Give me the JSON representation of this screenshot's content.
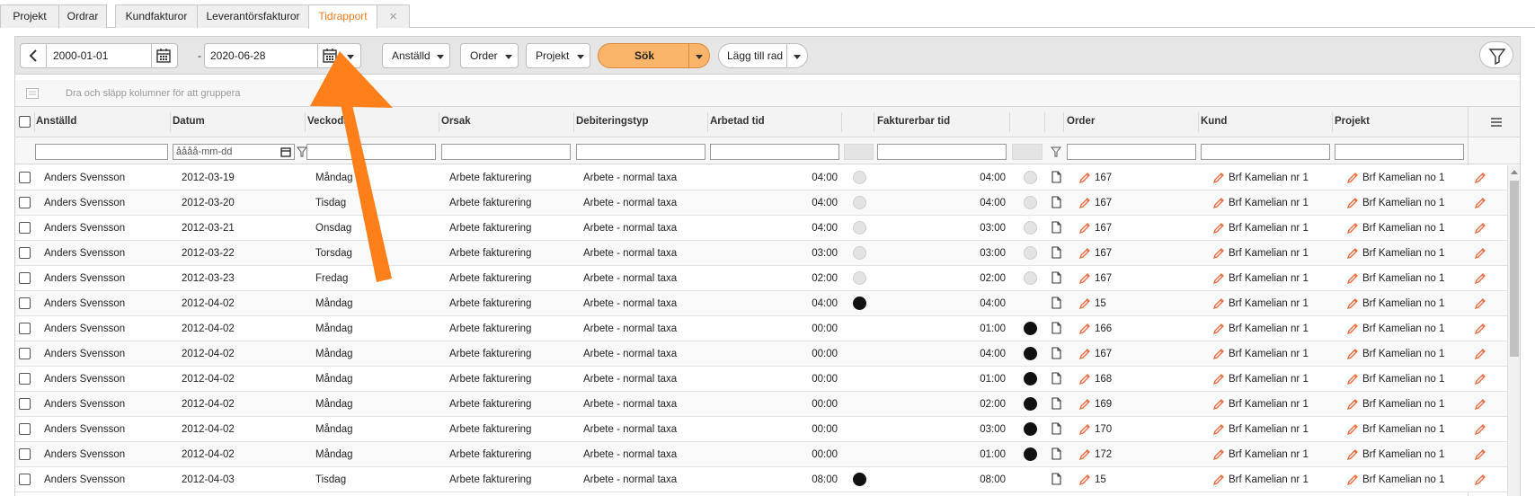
{
  "tabs": [
    {
      "label": "Projekt"
    },
    {
      "label": "Ordrar"
    },
    {
      "label": "Kundfakturor"
    },
    {
      "label": "Leverantörsfakturor"
    },
    {
      "label": "Tidrapport"
    },
    {
      "label": "×"
    }
  ],
  "active_tab": "Tidrapport",
  "toolbar": {
    "date_from": "2000-01-01",
    "date_sep": "-",
    "date_to": "2020-06-28",
    "employee_label": "Anställd",
    "order_label": "Order",
    "project_label": "Projekt",
    "search_label": "Sök",
    "add_row_label": "Lägg till rad"
  },
  "group_bar": {
    "text": "Dra och släpp kolumner för att gruppera"
  },
  "columns": {
    "employee": "Anställd",
    "date": "Datum",
    "weekday": "Veckodag",
    "reason": "Orsak",
    "billing_type": "Debiteringstyp",
    "worked": "Arbetad tid",
    "billable": "Fakturerbar tid",
    "order": "Order",
    "customer": "Kund",
    "project": "Projekt"
  },
  "filters": {
    "date_placeholder": "åååå-mm-dd"
  },
  "rows": [
    {
      "employee": "Anders Svensson",
      "date": "2012-03-19",
      "weekday": "Måndag",
      "reason": "Arbete fakturering",
      "billing": "Arbete - normal taxa",
      "worked": "04:00",
      "dot1": "gray",
      "billable": "04:00",
      "dot2": "gray",
      "order": "167",
      "customer": "Brf Kamelian nr 1",
      "project": "Brf Kamelian no 1"
    },
    {
      "employee": "Anders Svensson",
      "date": "2012-03-20",
      "weekday": "Tisdag",
      "reason": "Arbete fakturering",
      "billing": "Arbete - normal taxa",
      "worked": "04:00",
      "dot1": "gray",
      "billable": "04:00",
      "dot2": "gray",
      "order": "167",
      "customer": "Brf Kamelian nr 1",
      "project": "Brf Kamelian no 1"
    },
    {
      "employee": "Anders Svensson",
      "date": "2012-03-21",
      "weekday": "Onsdag",
      "reason": "Arbete fakturering",
      "billing": "Arbete - normal taxa",
      "worked": "04:00",
      "dot1": "gray",
      "billable": "03:00",
      "dot2": "gray",
      "order": "167",
      "customer": "Brf Kamelian nr 1",
      "project": "Brf Kamelian no 1"
    },
    {
      "employee": "Anders Svensson",
      "date": "2012-03-22",
      "weekday": "Torsdag",
      "reason": "Arbete fakturering",
      "billing": "Arbete - normal taxa",
      "worked": "03:00",
      "dot1": "gray",
      "billable": "03:00",
      "dot2": "gray",
      "order": "167",
      "customer": "Brf Kamelian nr 1",
      "project": "Brf Kamelian no 1"
    },
    {
      "employee": "Anders Svensson",
      "date": "2012-03-23",
      "weekday": "Fredag",
      "reason": "Arbete fakturering",
      "billing": "Arbete - normal taxa",
      "worked": "02:00",
      "dot1": "gray",
      "billable": "02:00",
      "dot2": "gray",
      "order": "167",
      "customer": "Brf Kamelian nr 1",
      "project": "Brf Kamelian no 1"
    },
    {
      "employee": "Anders Svensson",
      "date": "2012-04-02",
      "weekday": "Måndag",
      "reason": "Arbete fakturering",
      "billing": "Arbete - normal taxa",
      "worked": "04:00",
      "dot1": "black",
      "billable": "04:00",
      "dot2": "",
      "order": "15",
      "customer": "Brf Kamelian nr 1",
      "project": "Brf Kamelian no 1"
    },
    {
      "employee": "Anders Svensson",
      "date": "2012-04-02",
      "weekday": "Måndag",
      "reason": "Arbete fakturering",
      "billing": "Arbete - normal taxa",
      "worked": "00:00",
      "dot1": "",
      "billable": "01:00",
      "dot2": "black",
      "order": "166",
      "customer": "Brf Kamelian nr 1",
      "project": "Brf Kamelian no 1"
    },
    {
      "employee": "Anders Svensson",
      "date": "2012-04-02",
      "weekday": "Måndag",
      "reason": "Arbete fakturering",
      "billing": "Arbete - normal taxa",
      "worked": "00:00",
      "dot1": "",
      "billable": "04:00",
      "dot2": "black",
      "order": "167",
      "customer": "Brf Kamelian nr 1",
      "project": "Brf Kamelian no 1"
    },
    {
      "employee": "Anders Svensson",
      "date": "2012-04-02",
      "weekday": "Måndag",
      "reason": "Arbete fakturering",
      "billing": "Arbete - normal taxa",
      "worked": "00:00",
      "dot1": "",
      "billable": "01:00",
      "dot2": "black",
      "order": "168",
      "customer": "Brf Kamelian nr 1",
      "project": "Brf Kamelian no 1"
    },
    {
      "employee": "Anders Svensson",
      "date": "2012-04-02",
      "weekday": "Måndag",
      "reason": "Arbete fakturering",
      "billing": "Arbete - normal taxa",
      "worked": "00:00",
      "dot1": "",
      "billable": "02:00",
      "dot2": "black",
      "order": "169",
      "customer": "Brf Kamelian nr 1",
      "project": "Brf Kamelian no 1"
    },
    {
      "employee": "Anders Svensson",
      "date": "2012-04-02",
      "weekday": "Måndag",
      "reason": "Arbete fakturering",
      "billing": "Arbete - normal taxa",
      "worked": "00:00",
      "dot1": "",
      "billable": "03:00",
      "dot2": "black",
      "order": "170",
      "customer": "Brf Kamelian nr 1",
      "project": "Brf Kamelian no 1"
    },
    {
      "employee": "Anders Svensson",
      "date": "2012-04-02",
      "weekday": "Måndag",
      "reason": "Arbete fakturering",
      "billing": "Arbete - normal taxa",
      "worked": "00:00",
      "dot1": "",
      "billable": "01:00",
      "dot2": "black",
      "order": "172",
      "customer": "Brf Kamelian nr 1",
      "project": "Brf Kamelian no 1"
    },
    {
      "employee": "Anders Svensson",
      "date": "2012-04-03",
      "weekday": "Tisdag",
      "reason": "Arbete fakturering",
      "billing": "Arbete - normal taxa",
      "worked": "08:00",
      "dot1": "black",
      "billable": "08:00",
      "dot2": "",
      "order": "15",
      "customer": "Brf Kamelian nr 1",
      "project": "Brf Kamelian no 1"
    }
  ],
  "colors": {
    "accent": "#f07d20",
    "search_button": "#fbb56a",
    "arrow": "#ff7f1a"
  },
  "icons": [
    "chevron-left-icon",
    "calendar-icon",
    "caret-down-icon",
    "filter-icon",
    "menu-icon",
    "document-icon",
    "pencil-icon",
    "group-icon"
  ]
}
